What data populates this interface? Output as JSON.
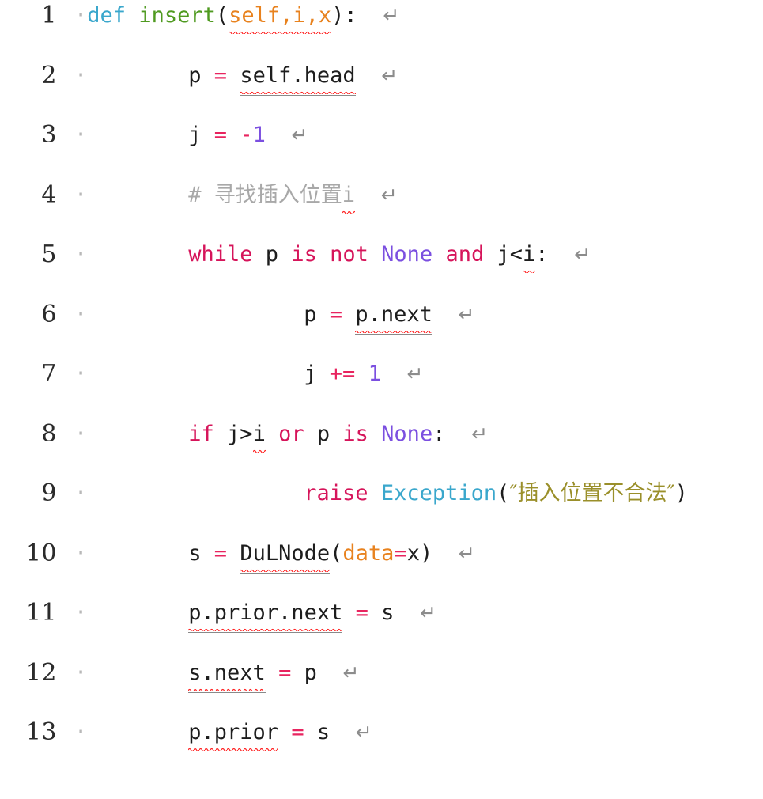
{
  "editor": {
    "language": "python",
    "background_color": "#ffffff",
    "line_count": 13,
    "return_glyph": "↵",
    "indent_dot": "·",
    "colors": {
      "keyword": "#d6145a",
      "def_keyword": "#3aa7cc",
      "function_name": "#4f9a20",
      "parameter": "#e8821e",
      "constant": "#7b4fe0",
      "operator": "#e8245f",
      "class_name": "#3aa7cc",
      "string": "#9a8f2a",
      "comment": "#a8a8a8",
      "plain": "#1d1d1d",
      "line_number": "#2b2b2b",
      "return_mark": "#8c8c8c",
      "spellcheck_squiggle": "#ff2222"
    }
  },
  "lines": [
    {
      "number": "1",
      "indent": 0,
      "tokens": [
        {
          "text": "def",
          "type": "def_keyword"
        },
        {
          "text": " ",
          "type": "plain"
        },
        {
          "text": "insert",
          "type": "function_name"
        },
        {
          "text": "(",
          "type": "punct"
        },
        {
          "text": "self,i,x",
          "type": "parameter",
          "squiggle": true
        },
        {
          "text": ")",
          "type": "punct"
        },
        {
          "text": ":",
          "type": "punct"
        }
      ]
    },
    {
      "number": "2",
      "indent": 1,
      "tokens": [
        {
          "text": "p",
          "type": "plain"
        },
        {
          "text": " ",
          "type": "plain"
        },
        {
          "text": "=",
          "type": "operator"
        },
        {
          "text": " ",
          "type": "plain"
        },
        {
          "text": "self.head",
          "type": "plain",
          "squiggle": true,
          "underline": true
        }
      ]
    },
    {
      "number": "3",
      "indent": 1,
      "tokens": [
        {
          "text": "j",
          "type": "plain"
        },
        {
          "text": " ",
          "type": "plain"
        },
        {
          "text": "=",
          "type": "operator"
        },
        {
          "text": " ",
          "type": "plain"
        },
        {
          "text": "-",
          "type": "operator"
        },
        {
          "text": "1",
          "type": "constant"
        }
      ]
    },
    {
      "number": "4",
      "indent": 1,
      "tokens": [
        {
          "text": "# ",
          "type": "comment"
        },
        {
          "text": "寻找插入位置",
          "type": "comment",
          "cjk": true
        },
        {
          "text": "i",
          "type": "comment",
          "squiggle": true
        }
      ]
    },
    {
      "number": "5",
      "indent": 1,
      "tokens": [
        {
          "text": "while",
          "type": "keyword"
        },
        {
          "text": " p ",
          "type": "plain"
        },
        {
          "text": "is",
          "type": "keyword"
        },
        {
          "text": " ",
          "type": "plain"
        },
        {
          "text": "not",
          "type": "keyword"
        },
        {
          "text": " ",
          "type": "plain"
        },
        {
          "text": "None",
          "type": "constant"
        },
        {
          "text": " ",
          "type": "plain"
        },
        {
          "text": "and",
          "type": "keyword"
        },
        {
          "text": " j<",
          "type": "plain"
        },
        {
          "text": "i",
          "type": "plain",
          "squiggle": true
        },
        {
          "text": ":",
          "type": "punct"
        }
      ]
    },
    {
      "number": "6",
      "indent": 2,
      "tokens": [
        {
          "text": "p",
          "type": "plain"
        },
        {
          "text": " ",
          "type": "plain"
        },
        {
          "text": "=",
          "type": "operator"
        },
        {
          "text": " ",
          "type": "plain"
        },
        {
          "text": "p.next",
          "type": "plain",
          "squiggle": true,
          "underline": true
        }
      ]
    },
    {
      "number": "7",
      "indent": 2,
      "tokens": [
        {
          "text": "j",
          "type": "plain"
        },
        {
          "text": " ",
          "type": "plain"
        },
        {
          "text": "+=",
          "type": "operator"
        },
        {
          "text": " ",
          "type": "plain"
        },
        {
          "text": "1",
          "type": "constant"
        }
      ]
    },
    {
      "number": "8",
      "indent": 1,
      "tokens": [
        {
          "text": "if",
          "type": "keyword"
        },
        {
          "text": " j>",
          "type": "plain"
        },
        {
          "text": "i",
          "type": "plain",
          "squiggle": true
        },
        {
          "text": " ",
          "type": "plain"
        },
        {
          "text": "or",
          "type": "keyword"
        },
        {
          "text": " p ",
          "type": "plain"
        },
        {
          "text": "is",
          "type": "keyword"
        },
        {
          "text": " ",
          "type": "plain"
        },
        {
          "text": "None",
          "type": "constant"
        },
        {
          "text": ":",
          "type": "punct"
        }
      ]
    },
    {
      "number": "9",
      "indent": 2,
      "tokens": [
        {
          "text": "raise",
          "type": "keyword"
        },
        {
          "text": " ",
          "type": "plain"
        },
        {
          "text": "Exception",
          "type": "class_name"
        },
        {
          "text": "(",
          "type": "punct"
        },
        {
          "text": "″插入位置不合法″",
          "type": "string",
          "cjk": true
        },
        {
          "text": ")",
          "type": "punct"
        }
      ],
      "no_return_mark": true
    },
    {
      "number": "10",
      "indent": 1,
      "tokens": [
        {
          "text": "s",
          "type": "plain"
        },
        {
          "text": " ",
          "type": "plain"
        },
        {
          "text": "=",
          "type": "operator"
        },
        {
          "text": " ",
          "type": "plain"
        },
        {
          "text": "DuLNode",
          "type": "plain",
          "squiggle": true,
          "underline": true
        },
        {
          "text": "(",
          "type": "punct"
        },
        {
          "text": "data",
          "type": "parameter"
        },
        {
          "text": "=",
          "type": "operator"
        },
        {
          "text": "x",
          "type": "plain"
        },
        {
          "text": ")",
          "type": "punct"
        }
      ]
    },
    {
      "number": "11",
      "indent": 1,
      "tokens": [
        {
          "text": "p.prior.next",
          "type": "plain",
          "squiggle": true,
          "underline": true
        },
        {
          "text": " ",
          "type": "plain"
        },
        {
          "text": "=",
          "type": "operator"
        },
        {
          "text": " ",
          "type": "plain"
        },
        {
          "text": "s",
          "type": "plain"
        }
      ]
    },
    {
      "number": "12",
      "indent": 1,
      "tokens": [
        {
          "text": "s.next",
          "type": "plain",
          "squiggle": true,
          "underline": true
        },
        {
          "text": " ",
          "type": "plain"
        },
        {
          "text": "=",
          "type": "operator"
        },
        {
          "text": " ",
          "type": "plain"
        },
        {
          "text": "p",
          "type": "plain"
        }
      ]
    },
    {
      "number": "13",
      "indent": 1,
      "tokens": [
        {
          "text": "p.prior",
          "type": "plain",
          "squiggle": true,
          "underline": true
        },
        {
          "text": " ",
          "type": "plain"
        },
        {
          "text": "=",
          "type": "operator"
        },
        {
          "text": " ",
          "type": "plain"
        },
        {
          "text": "s",
          "type": "plain"
        }
      ]
    }
  ]
}
